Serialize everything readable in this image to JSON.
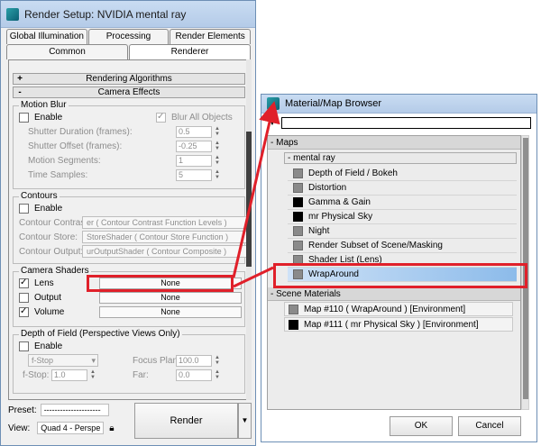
{
  "render_setup": {
    "title": "Render Setup: NVIDIA mental ray",
    "tabs_row1": [
      "Global Illumination",
      "Processing",
      "Render Elements"
    ],
    "tabs_row2": [
      "Common",
      "Renderer"
    ],
    "rollouts": [
      {
        "sign": "+",
        "label": "Rendering Algorithms"
      },
      {
        "sign": "-",
        "label": "Camera Effects"
      }
    ],
    "motion_blur": {
      "label": "Motion Blur",
      "enable": "Enable",
      "blur_all": "Blur All Objects",
      "fields": [
        {
          "label": "Shutter Duration (frames):",
          "value": "0.5"
        },
        {
          "label": "Shutter Offset (frames):",
          "value": "-0.25"
        },
        {
          "label": "Motion Segments:",
          "value": "1"
        },
        {
          "label": "Time Samples:",
          "value": "5"
        }
      ]
    },
    "contours": {
      "label": "Contours",
      "enable": "Enable",
      "fields": [
        {
          "label": "Contour Contrast:",
          "value": "er  ( Contour Contrast Function Levels )"
        },
        {
          "label": "Contour Store:",
          "value": "StoreShader  ( Contour Store Function )"
        },
        {
          "label": "Contour Output:",
          "value": "urOutputShader  ( Contour Composite )"
        }
      ]
    },
    "camera_shaders": {
      "label": "Camera Shaders",
      "rows": [
        {
          "label": "Lens",
          "value": "None",
          "checked": true
        },
        {
          "label": "Output",
          "value": "None",
          "checked": false
        },
        {
          "label": "Volume",
          "value": "None",
          "checked": true
        }
      ]
    },
    "dof": {
      "label": "Depth of Field (Perspective Views Only)",
      "enable": "Enable",
      "mode": "f-Stop",
      "fstop_label": "f-Stop:",
      "fstop_value": "1.0",
      "focus_label": "Focus Plane:",
      "focus_value": "100.0",
      "far_label": "Far:",
      "far_value": "0.0"
    },
    "bottom": {
      "preset_label": "Preset:",
      "preset_value": "---------------------",
      "view_label": "View:",
      "view_value": "Quad 4 - Perspe",
      "render_label": "Render"
    }
  },
  "material_browser": {
    "title": "Material/Map Browser",
    "maps_header": "- Maps",
    "mental_ray_header": "- mental ray",
    "items": [
      {
        "label": "Depth of Field / Bokeh",
        "swatch": "gray"
      },
      {
        "label": "Distortion",
        "swatch": "gray"
      },
      {
        "label": "Gamma & Gain",
        "swatch": "black"
      },
      {
        "label": "mr Physical Sky",
        "swatch": "black"
      },
      {
        "label": "Night",
        "swatch": "gray"
      },
      {
        "label": "Render Subset of Scene/Masking",
        "swatch": "gray"
      },
      {
        "label": "Shader List (Lens)",
        "swatch": "gray"
      },
      {
        "label": "WrapAround",
        "swatch": "gray",
        "selected": true
      }
    ],
    "scene_header": "- Scene Materials",
    "scene_items": [
      {
        "label": "Map #110  ( WrapAround )  [Environment]",
        "swatch": "gray"
      },
      {
        "label": "Map #111  ( mr Physical Sky )  [Environment]",
        "swatch": "black"
      }
    ],
    "ok_label": "OK",
    "cancel_label": "Cancel"
  },
  "colors": {
    "highlight": "#e0202a",
    "selection": "#8cbbea",
    "titlebar": "#c9dcf2"
  }
}
